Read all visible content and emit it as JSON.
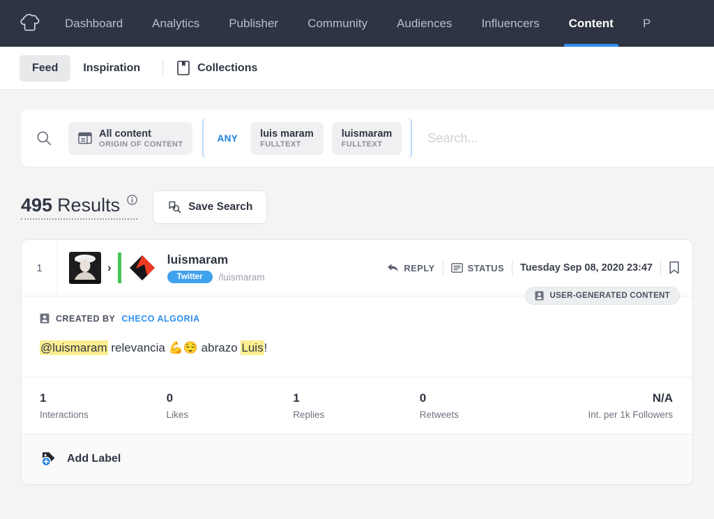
{
  "topnav": {
    "logo_icon": "chef-hat-logo-icon",
    "items": [
      {
        "label": "Dashboard",
        "active": false
      },
      {
        "label": "Analytics",
        "active": false
      },
      {
        "label": "Publisher",
        "active": false
      },
      {
        "label": "Community",
        "active": false
      },
      {
        "label": "Audiences",
        "active": false
      },
      {
        "label": "Influencers",
        "active": false
      },
      {
        "label": "Content",
        "active": true
      },
      {
        "label": "P",
        "active": false
      }
    ],
    "background": "#2e3444",
    "active_underline": "#2f8fef"
  },
  "subnav": {
    "tabs": [
      {
        "label": "Feed",
        "active": true
      },
      {
        "label": "Inspiration",
        "active": false
      }
    ],
    "collections": {
      "label": "Collections",
      "icon": "bookmark-page-icon"
    }
  },
  "search": {
    "search_icon": "search-icon",
    "origin_chip": {
      "icon": "content-origin-icon",
      "title": "All content",
      "subtitle": "ORIGIN OF CONTENT"
    },
    "operator": "ANY",
    "operator_color": "#1a7fe0",
    "term_chips": [
      {
        "title": "luis maram",
        "subtitle": "FULLTEXT"
      },
      {
        "title": "luismaram",
        "subtitle": "FULLTEXT"
      }
    ],
    "placeholder": "Search...",
    "value": ""
  },
  "results": {
    "count": "495",
    "label": "Results",
    "info_icon": "info-icon",
    "save_search": {
      "label": "Save Search",
      "icon": "save-search-icon"
    }
  },
  "post": {
    "index": "1",
    "avatar_alt": "user-avatar",
    "chevron_icon": "chevron-right-icon",
    "brand_icon": "brand-mark-icon",
    "username": "luismaram",
    "network": "Twitter",
    "network_color": "#3ea1ec",
    "handle": "/luismaram",
    "reply": {
      "label": "REPLY",
      "icon": "reply-arrow-icon"
    },
    "status": {
      "label": "STATUS",
      "icon": "status-card-icon"
    },
    "date": "Tuesday Sep 08, 2020 23:47",
    "bookmark_icon": "bookmark-icon",
    "ugc_badge": {
      "label": "USER-GENERATED CONTENT",
      "icon": "person-badge-icon"
    },
    "created_by": {
      "icon": "person-badge-icon",
      "prefix": "CREATED BY",
      "author": "CHECO ALGORIA",
      "author_color": "#2f8fef"
    },
    "text_parts": [
      {
        "text": "@luismaram",
        "highlight": true
      },
      {
        "text": " relevancia ",
        "highlight": false
      },
      {
        "text": "💪😌",
        "highlight": false
      },
      {
        "text": " abrazo ",
        "highlight": false
      },
      {
        "text": "Luis",
        "highlight": true
      },
      {
        "text": "!",
        "highlight": false
      }
    ],
    "highlight_color": "#fcee8f",
    "metrics": [
      {
        "value": "1",
        "label": "Interactions"
      },
      {
        "value": "0",
        "label": "Likes"
      },
      {
        "value": "1",
        "label": "Replies"
      },
      {
        "value": "0",
        "label": "Retweets"
      },
      {
        "value": "N/A",
        "label": "Int. per 1k Followers"
      }
    ],
    "add_label": {
      "label": "Add Label",
      "icon": "add-label-tag-icon"
    }
  }
}
